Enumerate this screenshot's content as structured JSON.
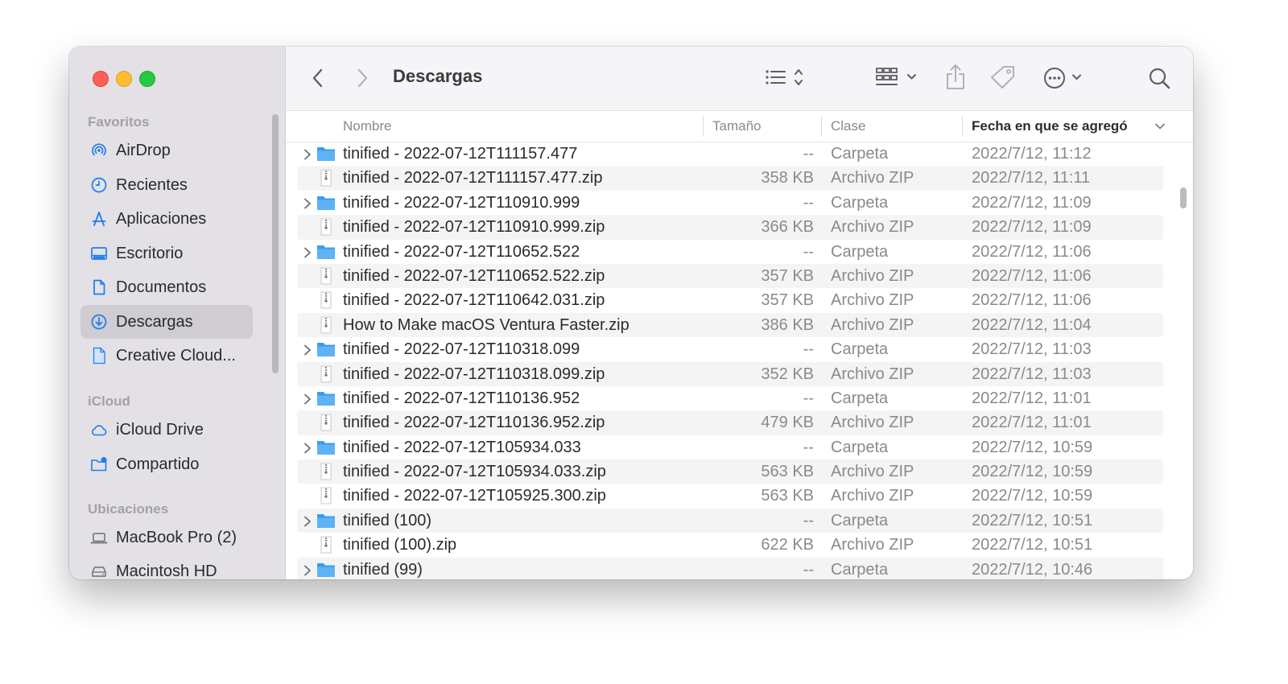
{
  "sidebar": {
    "favorites_header": "Favoritos",
    "favorites": [
      {
        "label": "AirDrop",
        "icon": "airdrop-icon"
      },
      {
        "label": "Recientes",
        "icon": "clock-icon"
      },
      {
        "label": "Aplicaciones",
        "icon": "applications-icon"
      },
      {
        "label": "Escritorio",
        "icon": "desktop-icon"
      },
      {
        "label": "Documentos",
        "icon": "document-icon"
      },
      {
        "label": "Descargas",
        "icon": "downloads-icon",
        "active": true
      },
      {
        "label": "Creative Cloud...",
        "icon": "file-icon"
      }
    ],
    "icloud_header": "iCloud",
    "icloud": [
      {
        "label": "iCloud Drive",
        "icon": "cloud-icon"
      },
      {
        "label": "Compartido",
        "icon": "shared-folder-icon"
      }
    ],
    "locations_header": "Ubicaciones",
    "locations": [
      {
        "label": "MacBook Pro (2)",
        "icon": "laptop-icon"
      },
      {
        "label": "Macintosh HD",
        "icon": "disk-icon"
      }
    ]
  },
  "toolbar": {
    "title": "Descargas"
  },
  "columns": {
    "name": "Nombre",
    "size": "Tamaño",
    "kind": "Clase",
    "date": "Fecha en que se agregó"
  },
  "colors": {
    "accent": "#1c7cf0",
    "folder": "#45aaf2"
  },
  "files": [
    {
      "name": "tinified - 2022-07-12T111157.477",
      "size": "--",
      "kind": "Carpeta",
      "date": "2022/7/12, 11:12",
      "type": "folder"
    },
    {
      "name": "tinified - 2022-07-12T111157.477.zip",
      "size": "358 KB",
      "kind": "Archivo ZIP",
      "date": "2022/7/12, 11:11",
      "type": "zip"
    },
    {
      "name": "tinified - 2022-07-12T110910.999",
      "size": "--",
      "kind": "Carpeta",
      "date": "2022/7/12, 11:09",
      "type": "folder"
    },
    {
      "name": "tinified - 2022-07-12T110910.999.zip",
      "size": "366 KB",
      "kind": "Archivo ZIP",
      "date": "2022/7/12, 11:09",
      "type": "zip"
    },
    {
      "name": "tinified - 2022-07-12T110652.522",
      "size": "--",
      "kind": "Carpeta",
      "date": "2022/7/12, 11:06",
      "type": "folder"
    },
    {
      "name": "tinified - 2022-07-12T110652.522.zip",
      "size": "357 KB",
      "kind": "Archivo ZIP",
      "date": "2022/7/12, 11:06",
      "type": "zip"
    },
    {
      "name": "tinified - 2022-07-12T110642.031.zip",
      "size": "357 KB",
      "kind": "Archivo ZIP",
      "date": "2022/7/12, 11:06",
      "type": "zip"
    },
    {
      "name": "How to Make macOS Ventura Faster.zip",
      "size": "386 KB",
      "kind": "Archivo ZIP",
      "date": "2022/7/12, 11:04",
      "type": "zip"
    },
    {
      "name": "tinified - 2022-07-12T110318.099",
      "size": "--",
      "kind": "Carpeta",
      "date": "2022/7/12, 11:03",
      "type": "folder"
    },
    {
      "name": "tinified - 2022-07-12T110318.099.zip",
      "size": "352 KB",
      "kind": "Archivo ZIP",
      "date": "2022/7/12, 11:03",
      "type": "zip"
    },
    {
      "name": "tinified - 2022-07-12T110136.952",
      "size": "--",
      "kind": "Carpeta",
      "date": "2022/7/12, 11:01",
      "type": "folder"
    },
    {
      "name": "tinified - 2022-07-12T110136.952.zip",
      "size": "479 KB",
      "kind": "Archivo ZIP",
      "date": "2022/7/12, 11:01",
      "type": "zip"
    },
    {
      "name": "tinified - 2022-07-12T105934.033",
      "size": "--",
      "kind": "Carpeta",
      "date": "2022/7/12, 10:59",
      "type": "folder"
    },
    {
      "name": "tinified - 2022-07-12T105934.033.zip",
      "size": "563 KB",
      "kind": "Archivo ZIP",
      "date": "2022/7/12, 10:59",
      "type": "zip"
    },
    {
      "name": "tinified - 2022-07-12T105925.300.zip",
      "size": "563 KB",
      "kind": "Archivo ZIP",
      "date": "2022/7/12, 10:59",
      "type": "zip"
    },
    {
      "name": "tinified (100)",
      "size": "--",
      "kind": "Carpeta",
      "date": "2022/7/12, 10:51",
      "type": "folder"
    },
    {
      "name": "tinified (100).zip",
      "size": "622 KB",
      "kind": "Archivo ZIP",
      "date": "2022/7/12, 10:51",
      "type": "zip"
    },
    {
      "name": "tinified (99)",
      "size": "--",
      "kind": "Carpeta",
      "date": "2022/7/12, 10:46",
      "type": "folder"
    }
  ]
}
